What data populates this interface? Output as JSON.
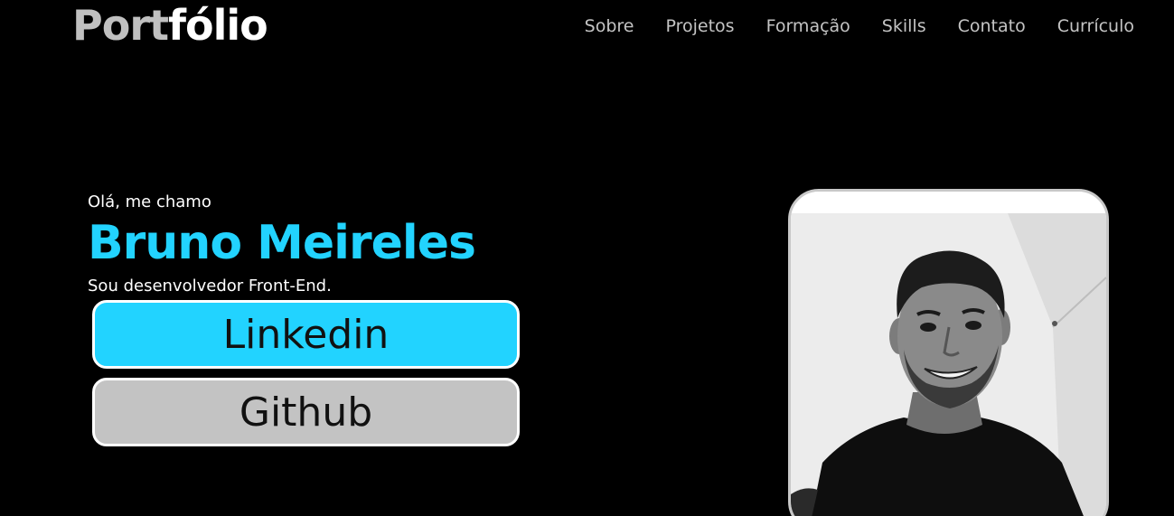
{
  "header": {
    "logo_part1": "Port",
    "logo_part2": "fólio",
    "nav": [
      {
        "label": "Sobre"
      },
      {
        "label": "Projetos"
      },
      {
        "label": "Formação"
      },
      {
        "label": "Skills"
      },
      {
        "label": "Contato"
      },
      {
        "label": "Currículo"
      }
    ]
  },
  "hero": {
    "greeting": "Olá, me chamo",
    "name": "Bruno Meireles",
    "role": "Sou desenvolvedor Front-End.",
    "buttons": {
      "linkedin": "Linkedin",
      "github": "Github"
    }
  },
  "colors": {
    "background": "#000000",
    "accent": "#22d3ff",
    "secondary_button": "#c3c3c3",
    "nav_text": "#c4c4c4"
  }
}
